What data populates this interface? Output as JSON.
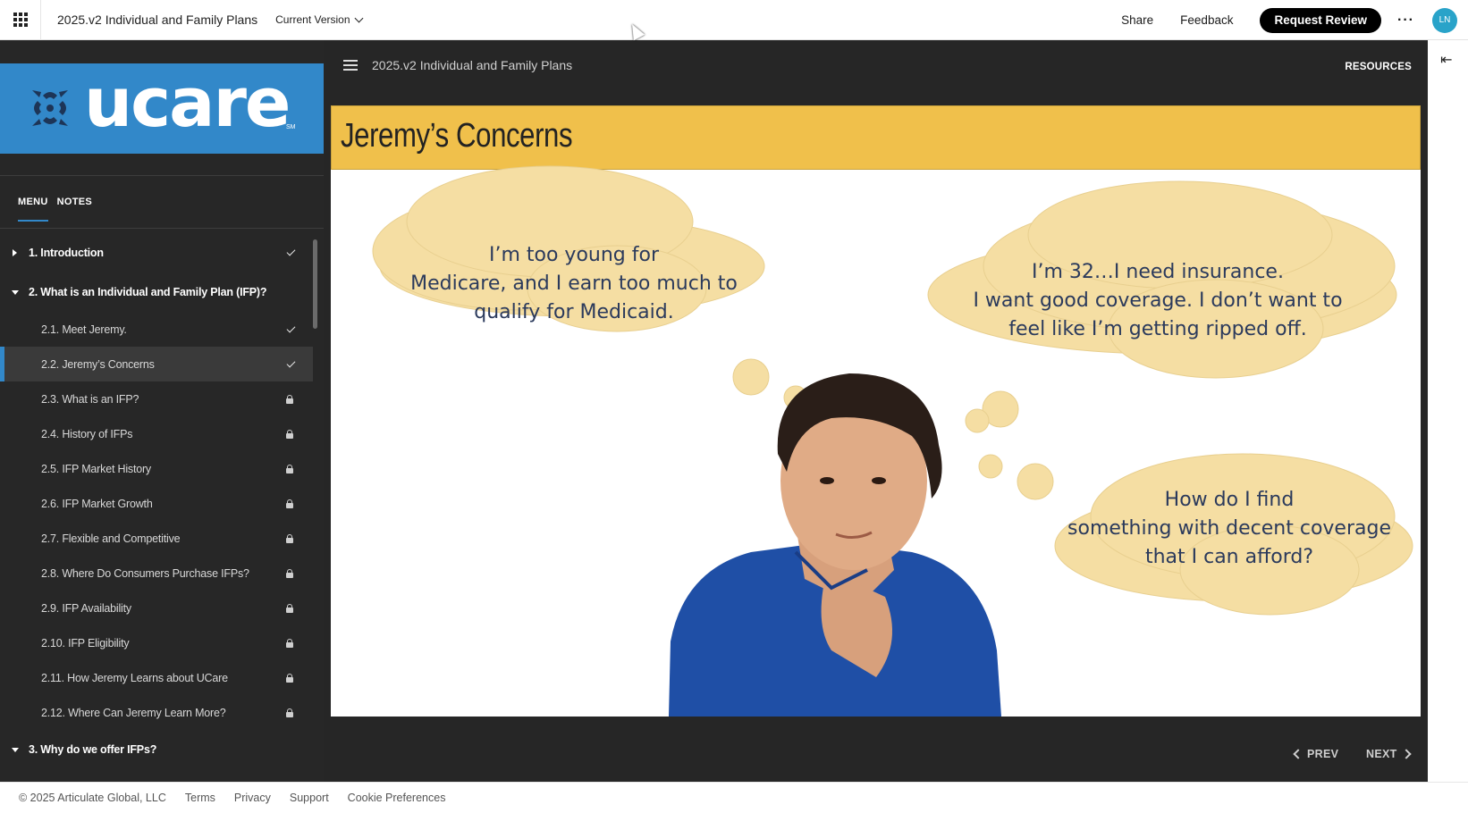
{
  "topbar": {
    "doc_title": "2025.v2 Individual and Family Plans",
    "version_label": "Current Version",
    "share": "Share",
    "feedback": "Feedback",
    "request_review": "Request Review",
    "more": "···",
    "avatar_initials": "LN"
  },
  "sidebar": {
    "logo_text": "ucare",
    "logo_sm": "SM",
    "tabs": [
      "MENU",
      "NOTES"
    ],
    "items": [
      {
        "label": "1. Introduction",
        "type": "section",
        "expanded": false,
        "status": "complete"
      },
      {
        "label": "2. What is an Individual and Family Plan (IFP)?",
        "type": "section",
        "expanded": true,
        "status": ""
      },
      {
        "label": "2.1. Meet Jeremy.",
        "type": "lesson",
        "status": "complete"
      },
      {
        "label": "2.2. Jeremy’s Concerns",
        "type": "lesson",
        "status": "complete",
        "active": true
      },
      {
        "label": "2.3. What is an IFP?",
        "type": "lesson",
        "status": "locked"
      },
      {
        "label": "2.4. History of IFPs",
        "type": "lesson",
        "status": "locked"
      },
      {
        "label": "2.5. IFP Market History",
        "type": "lesson",
        "status": "locked"
      },
      {
        "label": "2.6. IFP Market Growth",
        "type": "lesson",
        "status": "locked"
      },
      {
        "label": "2.7. Flexible and Competitive",
        "type": "lesson",
        "status": "locked"
      },
      {
        "label": "2.8. Where Do Consumers Purchase IFPs?",
        "type": "lesson",
        "status": "locked"
      },
      {
        "label": "2.9. IFP Availability",
        "type": "lesson",
        "status": "locked"
      },
      {
        "label": "2.10. IFP Eligibility",
        "type": "lesson",
        "status": "locked"
      },
      {
        "label": "2.11. How Jeremy Learns about UCare",
        "type": "lesson",
        "status": "locked"
      },
      {
        "label": "2.12. Where Can Jeremy Learn More?",
        "type": "lesson",
        "status": "locked"
      },
      {
        "label": "3. Why do we offer IFPs?",
        "type": "section",
        "expanded": true,
        "status": ""
      }
    ]
  },
  "main": {
    "course_title": "2025.v2 Individual and Family Plans",
    "resources": "RESOURCES",
    "slide_title": "Jeremy’s Concerns",
    "bubble_1": [
      "I’m too young for",
      "Medicare, and I earn too much to",
      "qualify for Medicaid."
    ],
    "bubble_2": [
      "I’m 32…I need insurance.",
      "I want good coverage. I don’t want to",
      "feel like I’m getting ripped off."
    ],
    "bubble_3": [
      "How do I find",
      "something with decent coverage",
      "that I can afford?"
    ],
    "prev": "PREV",
    "next": "NEXT"
  },
  "footer": {
    "copyright": "© 2025 Articulate Global, LLC",
    "links": [
      "Terms",
      "Privacy",
      "Support",
      "Cookie Preferences"
    ]
  },
  "colors": {
    "accent_blue": "#3288c9",
    "header_yellow": "#f0c04b",
    "bubble_fill": "#f5dea3",
    "bubble_text": "#2b3a5c",
    "sidebar_bg": "#272727"
  }
}
